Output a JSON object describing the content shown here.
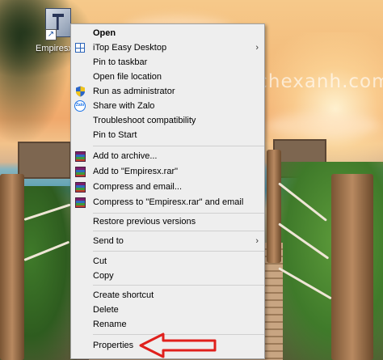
{
  "desktop": {
    "icon_label": "Empiresx Shortcut",
    "watermark": "taidechexanh.com"
  },
  "menu": {
    "items": [
      {
        "label": "Open",
        "bold": true,
        "icon": "none"
      },
      {
        "label": "iTop Easy Desktop",
        "icon": "itop-icon",
        "submenu": true
      },
      {
        "label": "Pin to taskbar",
        "icon": "none"
      },
      {
        "label": "Open file location",
        "icon": "none"
      },
      {
        "label": "Run as administrator",
        "icon": "uac-shield-icon"
      },
      {
        "label": "Share with Zalo",
        "icon": "zalo-icon"
      },
      {
        "label": "Troubleshoot compatibility",
        "icon": "none"
      },
      {
        "label": "Pin to Start",
        "icon": "none"
      },
      {
        "label": "Add to archive...",
        "icon": "winrar-icon"
      },
      {
        "label": "Add to \"Empiresx.rar\"",
        "icon": "winrar-icon"
      },
      {
        "label": "Compress and email...",
        "icon": "winrar-icon"
      },
      {
        "label": "Compress to \"Empiresx.rar\" and email",
        "icon": "winrar-icon"
      },
      {
        "label": "Restore previous versions",
        "icon": "none"
      },
      {
        "label": "Send to",
        "icon": "none",
        "submenu": true
      },
      {
        "label": "Cut",
        "icon": "none"
      },
      {
        "label": "Copy",
        "icon": "none"
      },
      {
        "label": "Create shortcut",
        "icon": "none"
      },
      {
        "label": "Delete",
        "icon": "none"
      },
      {
        "label": "Rename",
        "icon": "none"
      },
      {
        "label": "Properties",
        "icon": "none"
      }
    ],
    "submenu_glyph": "›",
    "zalo_text": "Zalo"
  },
  "annotation": {
    "arrow_color": "#e0201c",
    "points_to": "Properties"
  }
}
